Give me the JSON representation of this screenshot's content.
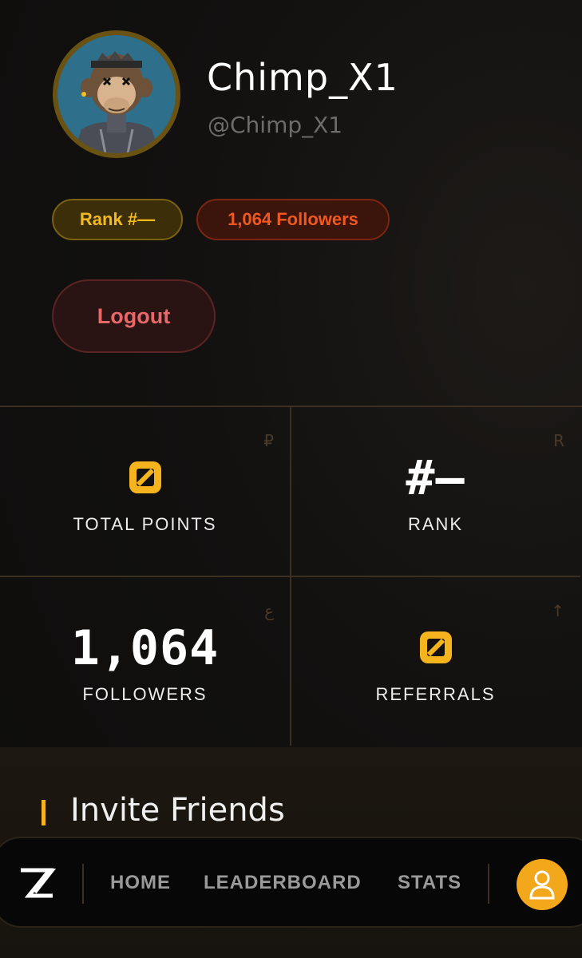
{
  "profile": {
    "display_name": "Chimp_X1",
    "handle": "@Chimp_X1",
    "avatar_icon": "ape-avatar"
  },
  "badges": {
    "rank": "Rank #—",
    "followers": "1,064 Followers"
  },
  "logout_label": "Logout",
  "stats": [
    {
      "value": "0",
      "label": "TOTAL POINTS",
      "corner": "₽",
      "value_style": "zero-icon"
    },
    {
      "value": "#—",
      "label": "RANK",
      "corner": "R"
    },
    {
      "value": "1,064",
      "label": "FOLLOWERS",
      "corner": "ع"
    },
    {
      "value": "0",
      "label": "REFERRALS",
      "corner": "↑",
      "value_style": "zero-icon"
    }
  ],
  "invite": {
    "title": "Invite Friends"
  },
  "nav": {
    "logo": "ZZ",
    "links": [
      "HOME",
      "LEADERBOARD",
      "STATS"
    ],
    "profile_icon": "user-icon"
  },
  "colors": {
    "accent": "#f5b41d",
    "followers_accent": "#f0581f",
    "logout_text": "#e8686a",
    "background": "#121110"
  }
}
